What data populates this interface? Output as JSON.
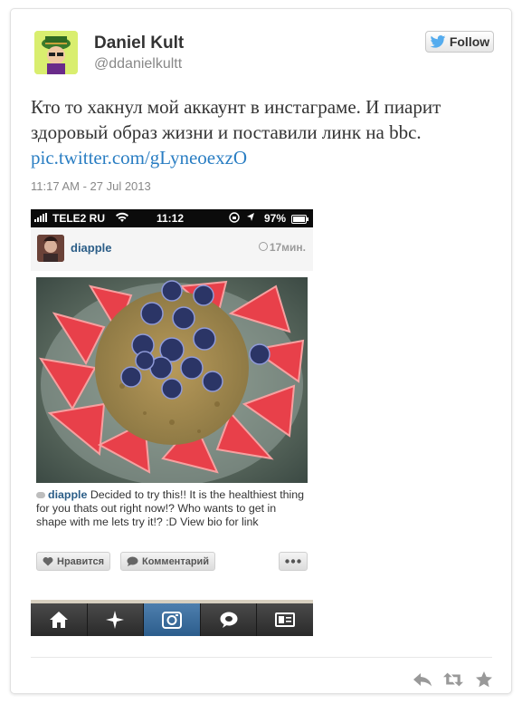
{
  "tweet": {
    "author_name": "Daniel Kult",
    "author_handle": "@ddanielkultt",
    "follow_label": "Follow",
    "text": "Кто то хакнул мой аккаунт в инстаграме. И пиарит здоровый образ жизни и поставили линк на bbc.",
    "link": "pic.twitter.com/gLyneoexzO",
    "timestamp": "11:17 AM - 27 Jul 2013"
  },
  "phone": {
    "status": {
      "carrier": "TELE2 RU",
      "time": "11:12",
      "battery": "97%"
    },
    "post": {
      "username": "diapple",
      "time": "17мин.",
      "caption_user": "diapple",
      "caption_text": "Decided to try this!! It is the healthiest thing for you thats out right now!? Who wants to get in shape with me lets try it!? :D View bio for link",
      "like_label": "Нравится",
      "comment_label": "Комментарий"
    },
    "tabs": [
      "home-icon",
      "explore-icon",
      "camera-icon",
      "news-icon",
      "profile-icon"
    ]
  },
  "colors": {
    "link": "#2a7ec3",
    "username": "#2b5d87",
    "twitter_bird": "#55acee",
    "active_tab": "#3b6d9c"
  }
}
